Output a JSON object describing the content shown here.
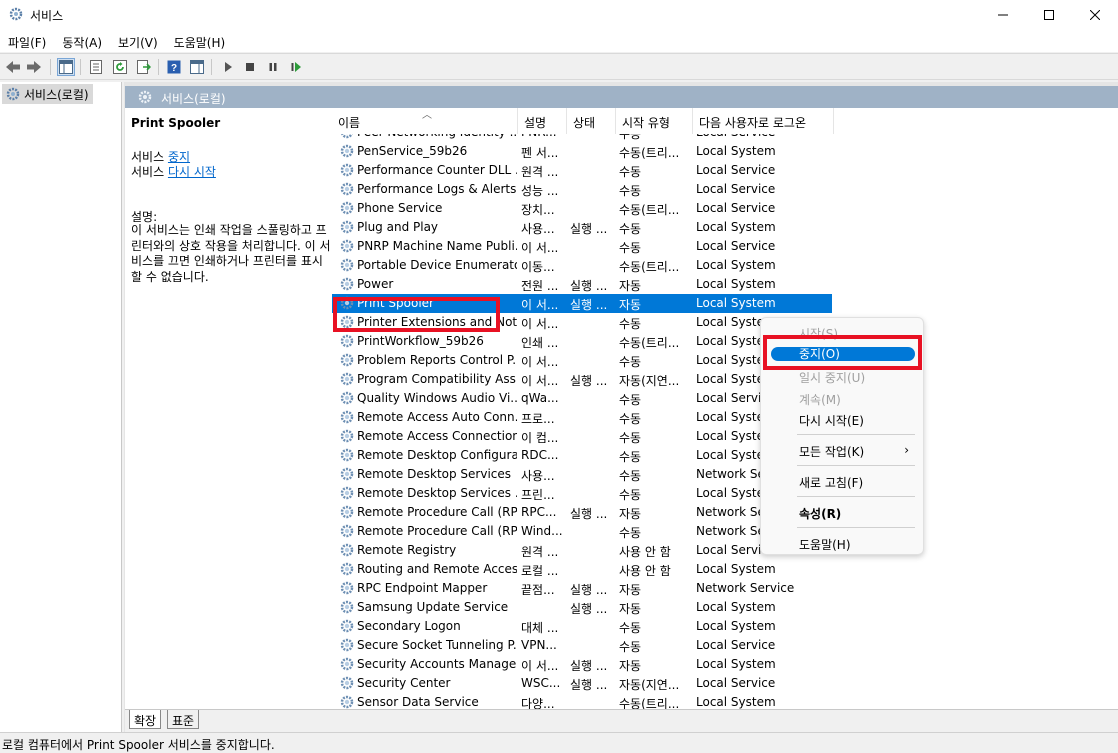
{
  "window": {
    "title": "서비스",
    "minimize_glyph": "—",
    "maximize_glyph": "☐",
    "close_glyph": "✕"
  },
  "menubar": [
    "파일(F)",
    "동작(A)",
    "보기(V)",
    "도움말(H)"
  ],
  "tree": {
    "item_label": "서비스(로컬)"
  },
  "header": {
    "title": "서비스(로컬)"
  },
  "description_pane": {
    "service_name": "Print Spooler",
    "action1_prefix": "서비스 ",
    "action1_link": "중지",
    "action2_prefix": "서비스 ",
    "action2_link": "다시 시작",
    "desc_label": "설명:",
    "desc_text": "이 서비스는 인쇄 작업을 스풀링하고 프린터와의 상호 작용을 처리합니다. 이 서비스를 끄면 인쇄하거나 프린터를 표시할 수 없습니다."
  },
  "columns": {
    "name": "이름",
    "desc": "설명",
    "status": "상태",
    "start": "시작 유형",
    "logon": "다음 사용자로 로그온"
  },
  "rows": [
    {
      "name": "Peer Networking Identity ...",
      "desc": "PNR...",
      "status": "",
      "start": "수동",
      "logon": "Local Service"
    },
    {
      "name": "PenService_59b26",
      "desc": "펜 서...",
      "status": "",
      "start": "수동(트리...",
      "logon": "Local System"
    },
    {
      "name": "Performance Counter DLL ...",
      "desc": "원격 ...",
      "status": "",
      "start": "수동",
      "logon": "Local Service"
    },
    {
      "name": "Performance Logs & Alerts",
      "desc": "성능 ...",
      "status": "",
      "start": "수동",
      "logon": "Local Service"
    },
    {
      "name": "Phone Service",
      "desc": "장치...",
      "status": "",
      "start": "수동(트리...",
      "logon": "Local Service"
    },
    {
      "name": "Plug and Play",
      "desc": "사용...",
      "status": "실행 ...",
      "start": "수동",
      "logon": "Local System"
    },
    {
      "name": "PNRP Machine Name Publi...",
      "desc": "이 서...",
      "status": "",
      "start": "수동",
      "logon": "Local Service"
    },
    {
      "name": "Portable Device Enumerato...",
      "desc": "이동...",
      "status": "",
      "start": "수동(트리...",
      "logon": "Local System"
    },
    {
      "name": "Power",
      "desc": "전원 ...",
      "status": "실행 ...",
      "start": "자동",
      "logon": "Local System"
    },
    {
      "name": "Print Spooler",
      "desc": "이 서...",
      "status": "실행 ...",
      "start": "자동",
      "logon": "Local System",
      "selected": true
    },
    {
      "name": "Printer Extensions and Noti...",
      "desc": "이 서...",
      "status": "",
      "start": "수동",
      "logon": "Local Syste"
    },
    {
      "name": "PrintWorkflow_59b26",
      "desc": "인쇄 ...",
      "status": "",
      "start": "수동(트리...",
      "logon": "Local Syste"
    },
    {
      "name": "Problem Reports Control P...",
      "desc": "이 서...",
      "status": "",
      "start": "수동",
      "logon": "Local Syste"
    },
    {
      "name": "Program Compatibility Assi...",
      "desc": "이 서...",
      "status": "실행 ...",
      "start": "자동(지연...",
      "logon": "Local Syste"
    },
    {
      "name": "Quality Windows Audio Vi...",
      "desc": "qWa...",
      "status": "",
      "start": "수동",
      "logon": "Local Servic"
    },
    {
      "name": "Remote Access Auto Conn...",
      "desc": "프로...",
      "status": "",
      "start": "수동",
      "logon": "Local Syste"
    },
    {
      "name": "Remote Access Connection...",
      "desc": "이 컴...",
      "status": "",
      "start": "수동",
      "logon": "Local Syste"
    },
    {
      "name": "Remote Desktop Configura...",
      "desc": "RDC...",
      "status": "",
      "start": "수동",
      "logon": "Local Syste"
    },
    {
      "name": "Remote Desktop Services",
      "desc": "사용...",
      "status": "",
      "start": "수동",
      "logon": "Network Se"
    },
    {
      "name": "Remote Desktop Services ...",
      "desc": "프린...",
      "status": "",
      "start": "수동",
      "logon": "Local Syste"
    },
    {
      "name": "Remote Procedure Call (RP...",
      "desc": "RPC...",
      "status": "실행 ...",
      "start": "자동",
      "logon": "Network Se"
    },
    {
      "name": "Remote Procedure Call (RP...",
      "desc": "Wind...",
      "status": "",
      "start": "수동",
      "logon": "Network Se"
    },
    {
      "name": "Remote Registry",
      "desc": "원격 ...",
      "status": "",
      "start": "사용 안 함",
      "logon": "Local Service"
    },
    {
      "name": "Routing and Remote Access",
      "desc": "로컬 ...",
      "status": "",
      "start": "사용 안 함",
      "logon": "Local System"
    },
    {
      "name": "RPC Endpoint Mapper",
      "desc": "끝점...",
      "status": "실행 ...",
      "start": "자동",
      "logon": "Network Service"
    },
    {
      "name": "Samsung Update Service",
      "desc": "",
      "status": "실행 ...",
      "start": "자동",
      "logon": "Local System"
    },
    {
      "name": "Secondary Logon",
      "desc": "대체 ...",
      "status": "",
      "start": "수동",
      "logon": "Local System"
    },
    {
      "name": "Secure Socket Tunneling P...",
      "desc": "VPN...",
      "status": "",
      "start": "수동",
      "logon": "Local Service"
    },
    {
      "name": "Security Accounts Manager",
      "desc": "이 서...",
      "status": "실행 ...",
      "start": "자동",
      "logon": "Local System"
    },
    {
      "name": "Security Center",
      "desc": "WSC...",
      "status": "실행 ...",
      "start": "자동(지연...",
      "logon": "Local Service"
    },
    {
      "name": "Sensor Data Service",
      "desc": "다양...",
      "status": "",
      "start": "수동(트리...",
      "logon": "Local System"
    }
  ],
  "context_menu": {
    "start": "시작(S)",
    "stop": "중지(O)",
    "pause": "일시 중지(U)",
    "resume": "계속(M)",
    "restart": "다시 시작(E)",
    "all_tasks": "모든 작업(K)",
    "refresh": "새로 고침(F)",
    "properties": "속성(R)",
    "help": "도움말(H)"
  },
  "tabs": {
    "extended": "확장",
    "standard": "표준"
  },
  "statusbar": {
    "text": "로컬 컴퓨터에서 Print Spooler 서비스를 중지합니다."
  },
  "colors": {
    "selection": "#0078d7",
    "highlight_box": "#e81123",
    "header_strip": "#9fb2c6",
    "link": "#0066cc"
  }
}
